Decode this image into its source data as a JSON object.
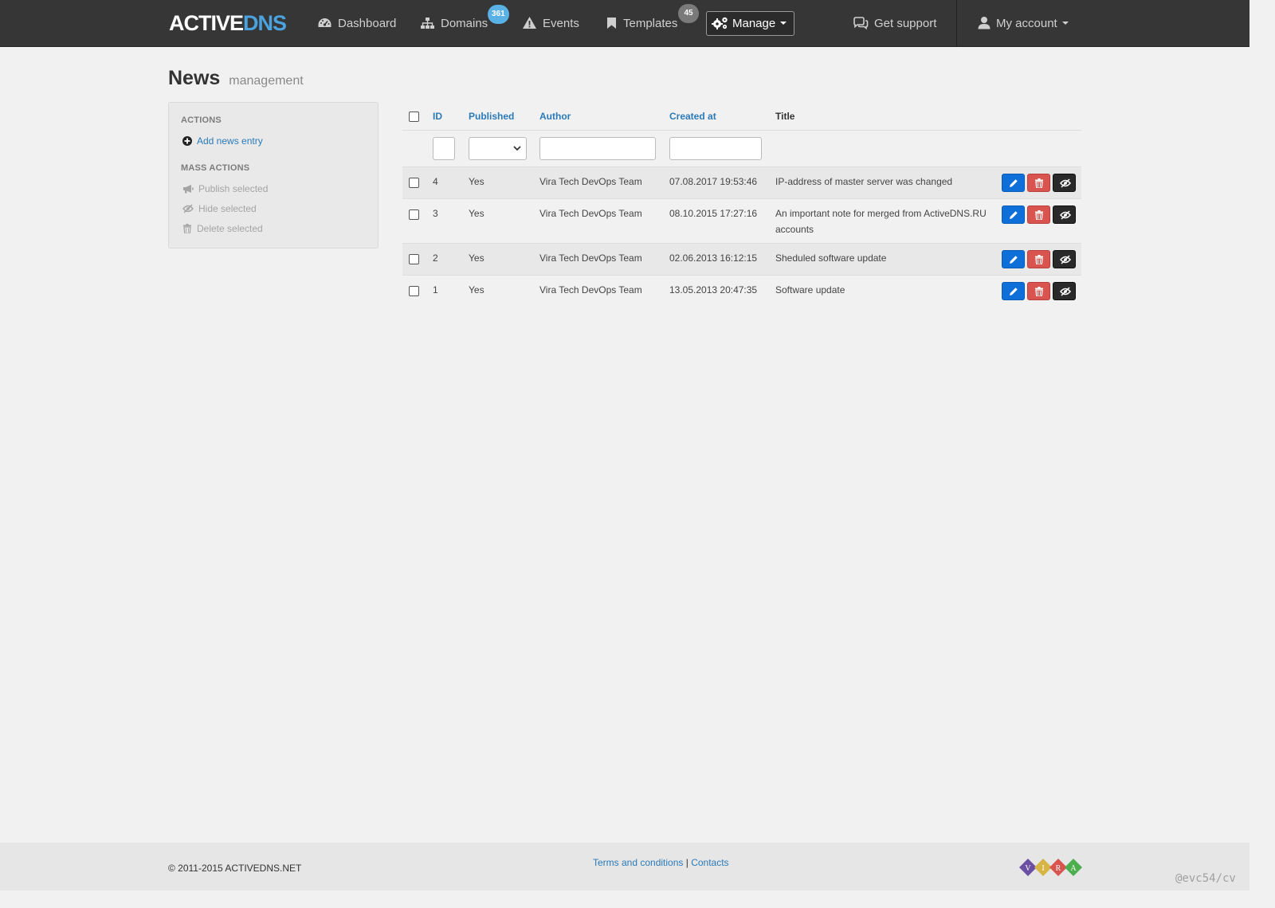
{
  "brand": {
    "part1": "ACTIVE",
    "part2": "DNS"
  },
  "nav": {
    "dashboard": "Dashboard",
    "domains": "Domains",
    "domains_badge": "361",
    "events": "Events",
    "templates": "Templates",
    "templates_badge": "45",
    "manage": "Manage",
    "support": "Get support",
    "account": "My account"
  },
  "page": {
    "title": "News",
    "subtitle": "management"
  },
  "sidebar": {
    "actions_heading": "Actions",
    "add_entry": "Add news entry",
    "mass_heading": "Mass actions",
    "publish": "Publish selected",
    "hide": "Hide selected",
    "delete": "Delete selected"
  },
  "table": {
    "columns": {
      "id": "ID",
      "published": "Published",
      "author": "Author",
      "created_at": "Created at",
      "title": "Title"
    },
    "rows": [
      {
        "id": "4",
        "published": "Yes",
        "author": "Vira Tech DevOps Team",
        "created_at": "07.08.2017 19:53:46",
        "title": "IP-address of master server was changed"
      },
      {
        "id": "3",
        "published": "Yes",
        "author": "Vira Tech DevOps Team",
        "created_at": "08.10.2015 17:27:16",
        "title": "An important note for merged from ActiveDNS.RU accounts"
      },
      {
        "id": "2",
        "published": "Yes",
        "author": "Vira Tech DevOps Team",
        "created_at": "02.06.2013 16:12:15",
        "title": "Sheduled software update"
      },
      {
        "id": "1",
        "published": "Yes",
        "author": "Vira Tech DevOps Team",
        "created_at": "13.05.2013 20:47:35",
        "title": "Software update"
      }
    ]
  },
  "footer": {
    "copyright": "© 2011-2015 ACTIVEDNS.NET",
    "terms": "Terms and conditions",
    "separator": "|",
    "contacts": "Contacts",
    "logo_letters": [
      "V",
      "I",
      "R",
      "A"
    ],
    "watermark": "@evc54/cv"
  },
  "colors": {
    "navbar": "#363636",
    "brand_accent": "#4aa3df",
    "link": "#2a7ab8",
    "edit_button": "#0e6fd8",
    "delete_button": "#d9534f",
    "visibility_button": "#2a2a2a",
    "badge_domains": "#59b1e6",
    "badge_templates": "#7a7a7a"
  }
}
